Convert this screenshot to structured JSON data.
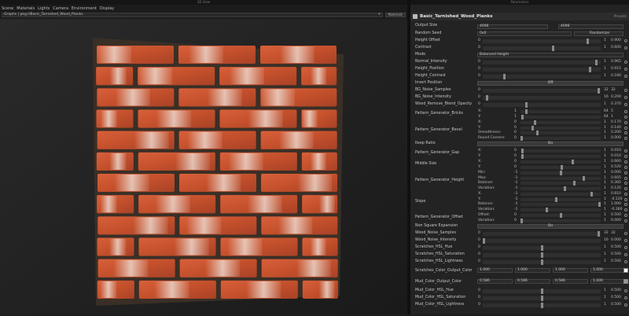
{
  "left_window": {
    "title": "3D View"
  },
  "menu": [
    "Scene",
    "Materials",
    "Lights",
    "Camera",
    "Environment",
    "Display"
  ],
  "graph_path": "Graphs | pkg://Basic_Tarnished_Wood_Planks",
  "view_btn": "Materials",
  "right_window": {
    "title": "Parameters"
  },
  "graph": {
    "name": "Basic_Tarnished_Wood_Planks",
    "preset": "Presets"
  },
  "params": {
    "output_size": {
      "label": "Output Size",
      "a": "4096",
      "b": "4096"
    },
    "random_seed": {
      "label": "Random Seed",
      "value": "0x0",
      "btn": "Randomize"
    },
    "height_offset": {
      "label": "Height Offset",
      "num": "0",
      "v1": "1",
      "v2": "0.900"
    },
    "contrast": {
      "label": "Contrast",
      "num": "0",
      "v1": "1",
      "v2": "0.600"
    },
    "mode": {
      "label": "Mode",
      "value": "Balanced Height"
    },
    "normal_intensity": {
      "label": "Normal_Intensity",
      "num": "0",
      "v1": "1",
      "v2": "0.965"
    },
    "height_position": {
      "label": "Height_Position",
      "num": "0",
      "v1": "1",
      "v2": "0.915"
    },
    "height_contrast": {
      "label": "Height_Contrast",
      "num": "0",
      "v1": "1",
      "v2": "0.180"
    },
    "invert_position": {
      "label": "Invert Position",
      "value": "Off"
    },
    "bg_noise_samples": {
      "label": "BG_Noise_Samples",
      "num": "0",
      "v1": "32",
      "v2": "32"
    },
    "bg_noise_intensity": {
      "label": "BG_Noise_Intensity",
      "num": "0",
      "v1": "16",
      "v2": "0.200"
    },
    "wood_remove_blend": {
      "label": "Wood_Remove_Blend_Opacity",
      "num": "0",
      "v1": "1",
      "v2": "0.370"
    },
    "pg_bricks": {
      "label": "Pattern_Generator_Bricks",
      "x": "X:",
      "y": "Y:",
      "xn": "1",
      "yn": "1",
      "xv": "64",
      "yv": "64",
      "xr": "5",
      "yr": "1"
    },
    "pg_bevel": {
      "label": "Pattern_Generator_Bevel",
      "x": "X:",
      "y": "Y:",
      "sm": "Smoothness:",
      "rc": "Round Corners:",
      "n0": "0",
      "n1": "0",
      "n2": "0",
      "n3": "0",
      "r0": "0.170",
      "r1": "0.140",
      "r2": "0.200",
      "r3": "0.000",
      "s0": "1",
      "s1": "1",
      "s2": "1",
      "s3": "1"
    },
    "keep_ratio": {
      "label": "Keep Ratio",
      "value": "On"
    },
    "pg_gap": {
      "label": "Pattern_Generator_Gap",
      "x": "X:",
      "y": "Y:",
      "n0": "0",
      "n1": "0",
      "s0": "1",
      "s1": "1",
      "r0": "0.010",
      "r1": "0.010"
    },
    "middle_size": {
      "label": "Middle Size",
      "x": "X:",
      "y": "Y:",
      "n0": "0",
      "n1": "0",
      "s0": "1",
      "s1": "1",
      "r0": "0.660",
      "r1": "0.520"
    },
    "pg_height": {
      "label": "Pattern_Generator_Height",
      "min": "Min:",
      "max": "Max:",
      "bal": "Balance:",
      "var": "Variation:",
      "n0": "-1",
      "n1": "-1",
      "n2": "-1",
      "n3": "-1",
      "s0": "1",
      "s1": "1",
      "s2": "1",
      "s3": "1",
      "r0": "0.000",
      "r1": "0.605",
      "r2": "0.360",
      "r3": "0.120"
    },
    "slope": {
      "label": "Slope",
      "x": "X:",
      "y": "Y:",
      "bal": "Balance:",
      "var": "Variation:",
      "n0": "-1",
      "n1": "-1",
      "n2": "-1",
      "n3": "-1",
      "s0": "1",
      "s1": "1",
      "s2": "1",
      "s3": "1",
      "r0": "0.810",
      "r1": "-0.120",
      "r2": "1.000",
      "r3": "-0.360"
    },
    "pg_offset": {
      "label": "Pattern_Generator_Offset",
      "off": "Offset:",
      "var": "Variation:",
      "n0": "0",
      "n1": "0",
      "s0": "1",
      "s1": "1",
      "r0": "0.500",
      "r1": "0.000"
    },
    "nonsquare": {
      "label": "Non Square Expansion",
      "value": "On"
    },
    "wood_noise_samples": {
      "label": "Wood_Noise_Samples",
      "num": "0",
      "v1": "32",
      "v2": "32"
    },
    "wood_noise_intensity": {
      "label": "Wood_Noise_Intensity",
      "num": "0",
      "v1": "16",
      "v2": "0.000"
    },
    "scr_hue": {
      "label": "Scratches_HSL_Hue",
      "num": "0",
      "v1": "1",
      "v2": "0.500"
    },
    "scr_sat": {
      "label": "Scratches_HSL_Saturation",
      "num": "0",
      "v1": "1",
      "v2": "0.500"
    },
    "scr_light": {
      "label": "Scratches_HSL_Lightness",
      "num": "0",
      "v1": "1",
      "v2": "0.500"
    },
    "scr_color": {
      "label": "Scratches_Color_Output_Color",
      "c0": "1.000",
      "c1": "1.000",
      "c2": "1.000",
      "c3": "1.000",
      "swatch": "#ffffff"
    },
    "mud_color": {
      "label": "Mud_Color_Output_Color",
      "c0": "0.586",
      "c1": "0.586",
      "c2": "0.586",
      "c3": "1.000",
      "swatch": "#959595"
    },
    "mud_hue": {
      "label": "Mud_Color_HSL_Hue",
      "num": "0",
      "v1": "1",
      "v2": "0.500"
    },
    "mud_sat": {
      "label": "Mud_Color_HSL_Saturation",
      "num": "0",
      "v1": "1",
      "v2": "0.500"
    },
    "mud_light": {
      "label": "Mud_Color_HSL_Lightness",
      "num": "0",
      "v1": "1",
      "v2": "0.500"
    }
  },
  "colors": {
    "brick": "#c9532e",
    "mortar": "#3a2f26",
    "bg": "#1b1b1b"
  }
}
